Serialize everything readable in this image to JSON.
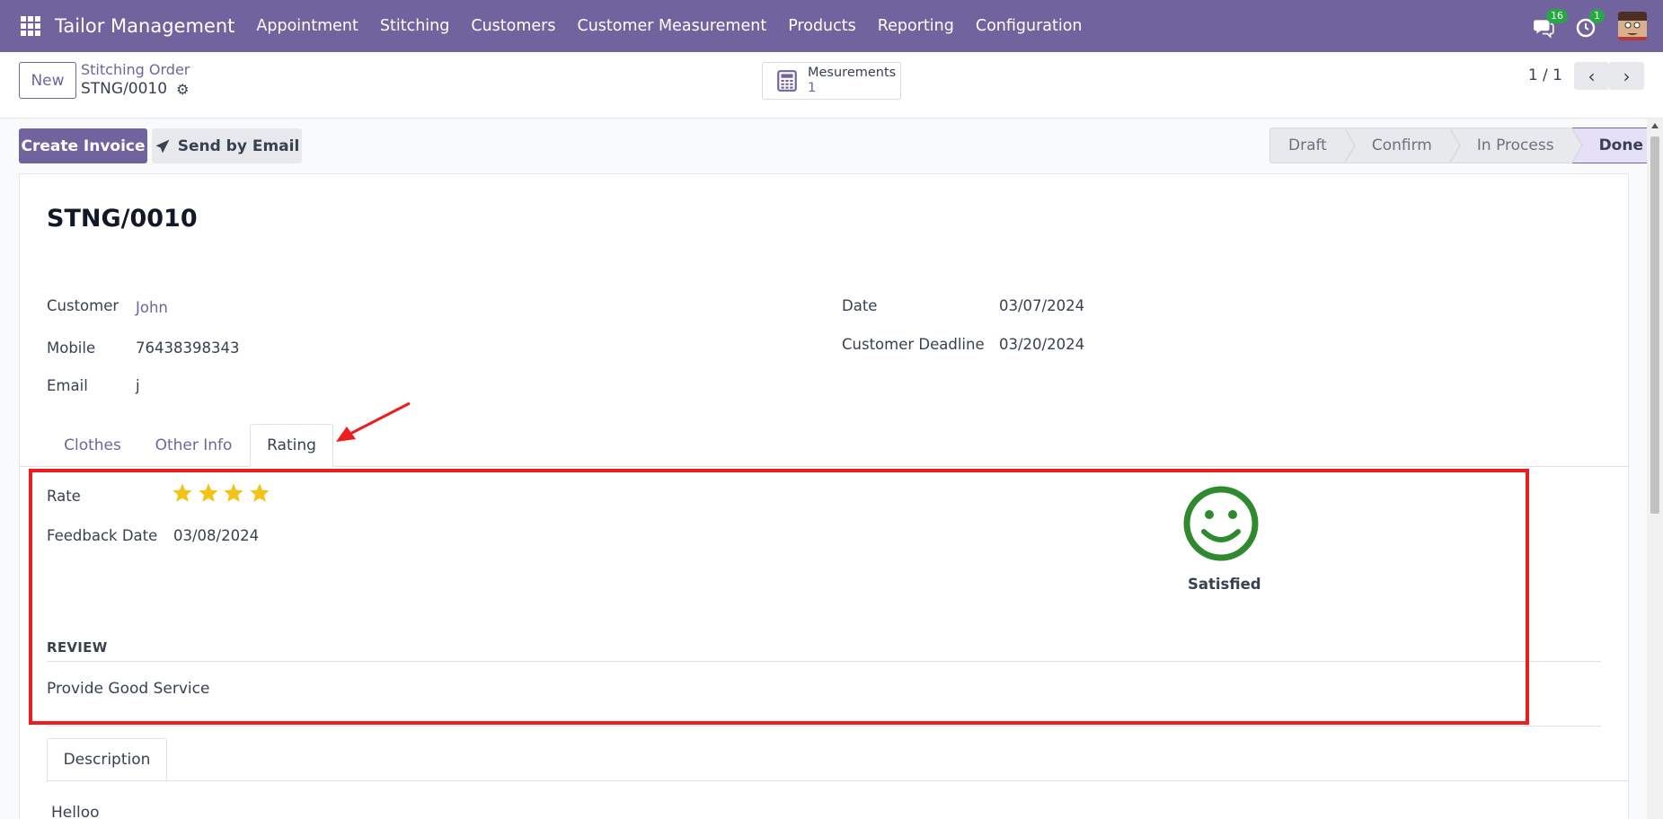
{
  "navbar": {
    "brand": "Tailor Management",
    "menu": [
      "Appointment",
      "Stitching",
      "Customers",
      "Customer Measurement",
      "Products",
      "Reporting",
      "Configuration"
    ],
    "messages_count": "16",
    "activities_count": "1",
    "bar_color": "#71639e"
  },
  "control": {
    "new_label": "New",
    "breadcrumb": "Stitching Order",
    "record": "STNG/0010",
    "smart_button_label": "Mesurements",
    "smart_button_value": "1",
    "pager": "1 / 1"
  },
  "actions": {
    "create_invoice": "Create Invoice",
    "send_email": "Send by Email"
  },
  "statusbar": [
    "Draft",
    "Confirm",
    "In Process",
    "Done"
  ],
  "form": {
    "title": "STNG/0010",
    "customer_label": "Customer",
    "customer_value": "John",
    "mobile_label": "Mobile",
    "mobile_value": "76438398343",
    "email_label": "Email",
    "email_value": "j",
    "date_label": "Date",
    "date_value": "03/07/2024",
    "deadline_label": "Customer Deadline",
    "deadline_value": "03/20/2024"
  },
  "tabs": [
    "Clothes",
    "Other Info",
    "Rating"
  ],
  "rating": {
    "rate_label": "Rate",
    "stars": 4,
    "feedback_date_label": "Feedback Date",
    "feedback_date_value": "03/08/2024",
    "sentiment": "Satisfied",
    "review_heading": "REVIEW",
    "review_text": "Provide Good Service"
  },
  "description": {
    "tab": "Description",
    "text": "Helloo"
  }
}
